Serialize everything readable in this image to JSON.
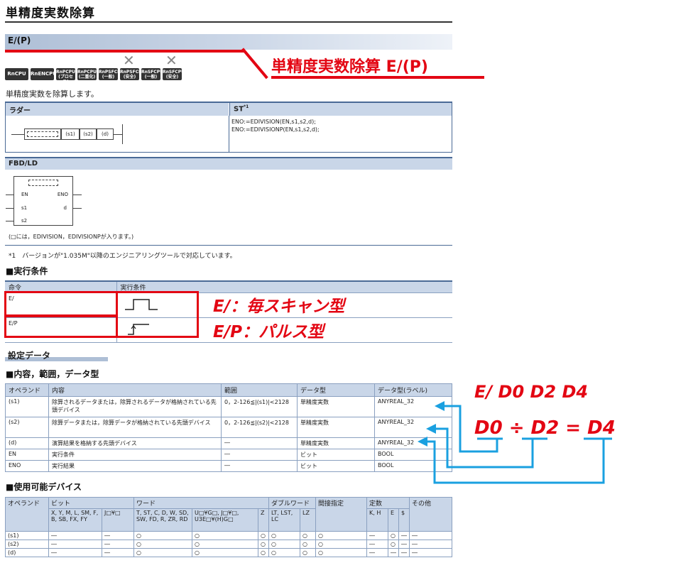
{
  "title": "単精度実数除算",
  "instruction_bar": "E/(P)",
  "callout_title": "単精度実数除算 E/(P)",
  "cpus": [
    {
      "top": "RnCPU",
      "bottom": "",
      "crossed": false,
      "wide": true
    },
    {
      "top": "RnENCPU",
      "bottom": "",
      "crossed": false,
      "wide": true
    },
    {
      "top": "RnPCPU",
      "bottom": "(プロセス)",
      "crossed": false,
      "wide": false
    },
    {
      "top": "RnPCPU",
      "bottom": "(二重化)",
      "crossed": false,
      "wide": false
    },
    {
      "top": "RnPSFCPU",
      "bottom": "(一般)",
      "crossed": false,
      "wide": false
    },
    {
      "top": "RnPSFCPU",
      "bottom": "(安全)",
      "crossed": true,
      "wide": false
    },
    {
      "top": "RnSFCPU",
      "bottom": "(一般)",
      "crossed": false,
      "wide": false
    },
    {
      "top": "RnSFCPU",
      "bottom": "(安全)",
      "crossed": true,
      "wide": false
    }
  ],
  "description": "単精度実数を除算します。",
  "ladder": {
    "header_ladder": "ラダー",
    "header_st": "ST",
    "st_note": "*1",
    "operands": [
      "(s1)",
      "(s2)",
      "(d)"
    ],
    "st_lines": [
      "ENO:=EDIVISION(EN,s1,s2,d);",
      "ENO:=EDIVISIONP(EN,s1,s2,d);"
    ]
  },
  "fbd": {
    "header": "FBD/LD",
    "in_labels": [
      "EN",
      "s1",
      "s2"
    ],
    "out_labels": [
      "ENO",
      "d"
    ],
    "note": "(□には，EDIVISION，EDIVISIONPが入ります。)"
  },
  "footnote": "*1　バージョンが\"1.035M\"以降のエンジニアリングツールで対応しています。",
  "exec_section": "■実行条件",
  "exec_table": {
    "headers": [
      "命令",
      "実行条件"
    ],
    "rows": [
      {
        "cmd": "E/"
      },
      {
        "cmd": "E/P"
      }
    ]
  },
  "callout_scan": "E/：毎スキャン型",
  "callout_pulse": "E/P：パルス型",
  "set_data": "設定データ",
  "content_section": "■内容，範囲，データ型",
  "ops_table": {
    "headers": [
      "オペランド",
      "内容",
      "範囲",
      "データ型",
      "データ型(ラベル)"
    ],
    "rows": [
      {
        "op": "(s1)",
        "desc": "除算されるデータまたは，除算されるデータが格納されている先頭デバイス",
        "range": "0，2-126≦|(s1)|<2128",
        "type": "単精度実数",
        "label": "ANYREAL_32"
      },
      {
        "op": "(s2)",
        "desc": "除算データまたは，除算データが格納されている先頭デバイス",
        "range": "0，2-126≦|(s2)|<2128",
        "type": "単精度実数",
        "label": "ANYREAL_32"
      },
      {
        "op": "(d)",
        "desc": "演算結果を格納する先頭デバイス",
        "range": "―",
        "type": "単精度実数",
        "label": "ANYREAL_32"
      },
      {
        "op": "EN",
        "desc": "実行条件",
        "range": "―",
        "type": "ビット",
        "label": "BOOL"
      },
      {
        "op": "ENO",
        "desc": "実行結果",
        "range": "―",
        "type": "ビット",
        "label": "BOOL"
      }
    ]
  },
  "callout_example": "E/ D0 D2 D4",
  "callout_equation": "D0 ÷ D2 = D4",
  "device_section": "■使用可能デバイス",
  "dev_table": {
    "h_operand": "オペランド",
    "h_bit": "ビット",
    "h_word": "ワード",
    "h_dword": "ダブルワード",
    "h_indirect": "間接指定",
    "h_const": "定数",
    "h_other": "その他",
    "sub": [
      "X, Y, M, L, SM, F, B, SB, FX, FY",
      "J□¥□",
      "T, ST, C, D, W, SD, SW, FD, R, ZR, RD",
      "U□¥G□, J□¥□, U3E□¥(H)G□",
      "Z",
      "LT, LST, LC",
      "LZ",
      "K, H",
      "E",
      "$"
    ],
    "rows": [
      {
        "op": "(s1)",
        "cells": [
          "―",
          "―",
          "○",
          "○",
          "○",
          "○",
          "○",
          "○",
          "―",
          "○",
          "―",
          "―"
        ]
      },
      {
        "op": "(s2)",
        "cells": [
          "―",
          "―",
          "○",
          "○",
          "○",
          "○",
          "○",
          "○",
          "―",
          "○",
          "―",
          "―"
        ]
      },
      {
        "op": "(d)",
        "cells": [
          "―",
          "―",
          "○",
          "○",
          "○",
          "○",
          "○",
          "○",
          "―",
          "―",
          "―",
          "―"
        ]
      }
    ]
  },
  "colors": {
    "accent_red": "#e30613",
    "arrow_blue": "#1aa0e0",
    "header_blue": "#c9d6e8"
  }
}
